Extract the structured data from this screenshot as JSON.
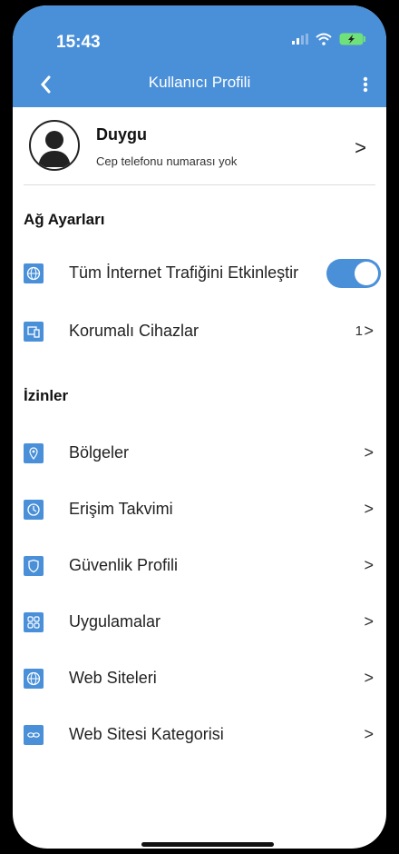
{
  "status_bar": {
    "time": "15:43"
  },
  "nav": {
    "title": "Kullanıcı Profili"
  },
  "profile": {
    "name": "Duygu",
    "subtitle": "Cep telefonu numarası yok",
    "chevron": ">"
  },
  "network": {
    "heading": "Ağ Ayarları",
    "items": [
      {
        "label": "Tüm İnternet Trafiğini Etkinleştir",
        "icon": "globe-icon",
        "toggle_on": true
      },
      {
        "label": "Korumalı Cihazlar",
        "icon": "devices-icon",
        "count": "1",
        "chevron": ">"
      }
    ]
  },
  "permissions": {
    "heading": "İzinler",
    "items": [
      {
        "label": "Bölgeler",
        "icon": "location-pin-icon",
        "chevron": ">"
      },
      {
        "label": "Erişim Takvimi",
        "icon": "clock-icon",
        "chevron": ">"
      },
      {
        "label": "Güvenlik Profili",
        "icon": "shield-icon",
        "chevron": ">"
      },
      {
        "label": "Uygulamalar",
        "icon": "apps-grid-icon",
        "chevron": ">"
      },
      {
        "label": "Web Siteleri",
        "icon": "globe-icon",
        "chevron": ">"
      },
      {
        "label": "Web Sitesi Kategorisi",
        "icon": "link-icon",
        "chevron": ">"
      }
    ]
  },
  "colors": {
    "accent": "#4a90d9",
    "battery": "#6fe07a"
  }
}
